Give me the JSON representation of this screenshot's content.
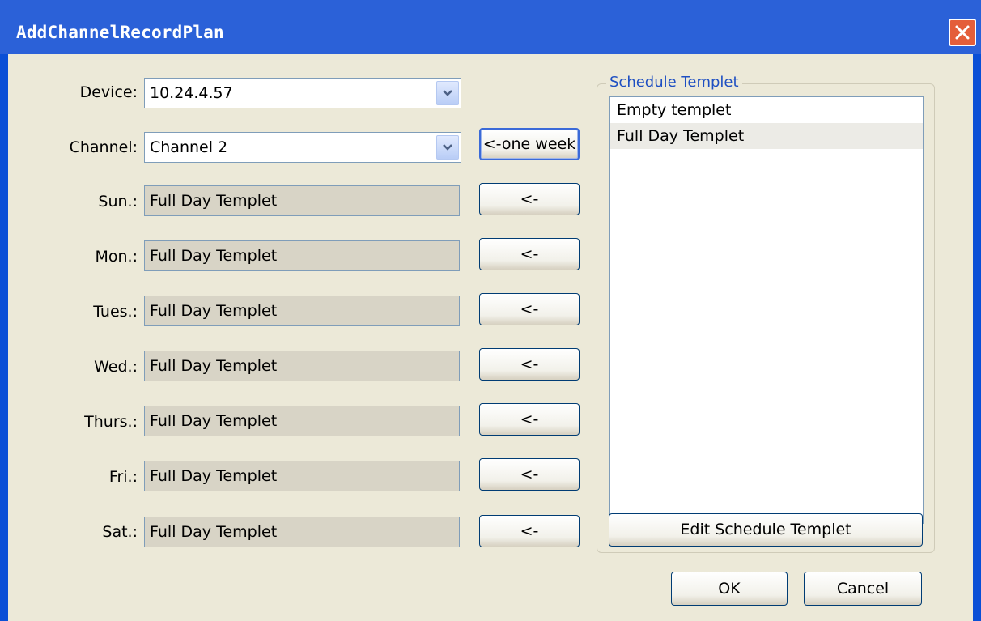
{
  "window": {
    "title": "AddChannelRecordPlan"
  },
  "form": {
    "device_label": "Device:",
    "device_value": "10.24.4.57",
    "channel_label": "Channel:",
    "channel_value": "Channel 2",
    "one_week_button": "<-one week"
  },
  "days": [
    {
      "label": "Sun.:",
      "value": "Full Day Templet",
      "button": "<-"
    },
    {
      "label": "Mon.:",
      "value": "Full Day Templet",
      "button": "<-"
    },
    {
      "label": "Tues.:",
      "value": "Full Day Templet",
      "button": "<-"
    },
    {
      "label": "Wed.:",
      "value": "Full Day Templet",
      "button": "<-"
    },
    {
      "label": "Thurs.:",
      "value": "Full Day Templet",
      "button": "<-"
    },
    {
      "label": "Fri.:",
      "value": "Full Day Templet",
      "button": "<-"
    },
    {
      "label": "Sat.:",
      "value": "Full Day Templet",
      "button": "<-"
    }
  ],
  "schedule": {
    "group_title": "Schedule Templet",
    "items": [
      "Empty templet",
      "Full Day Templet"
    ],
    "edit_button": "Edit Schedule Templet"
  },
  "footer": {
    "ok": "OK",
    "cancel": "Cancel"
  },
  "colors": {
    "titlebar": "#2b61d8",
    "background": "#ece9d8",
    "close": "#e45e3a",
    "group_title": "#1e4fc2"
  }
}
